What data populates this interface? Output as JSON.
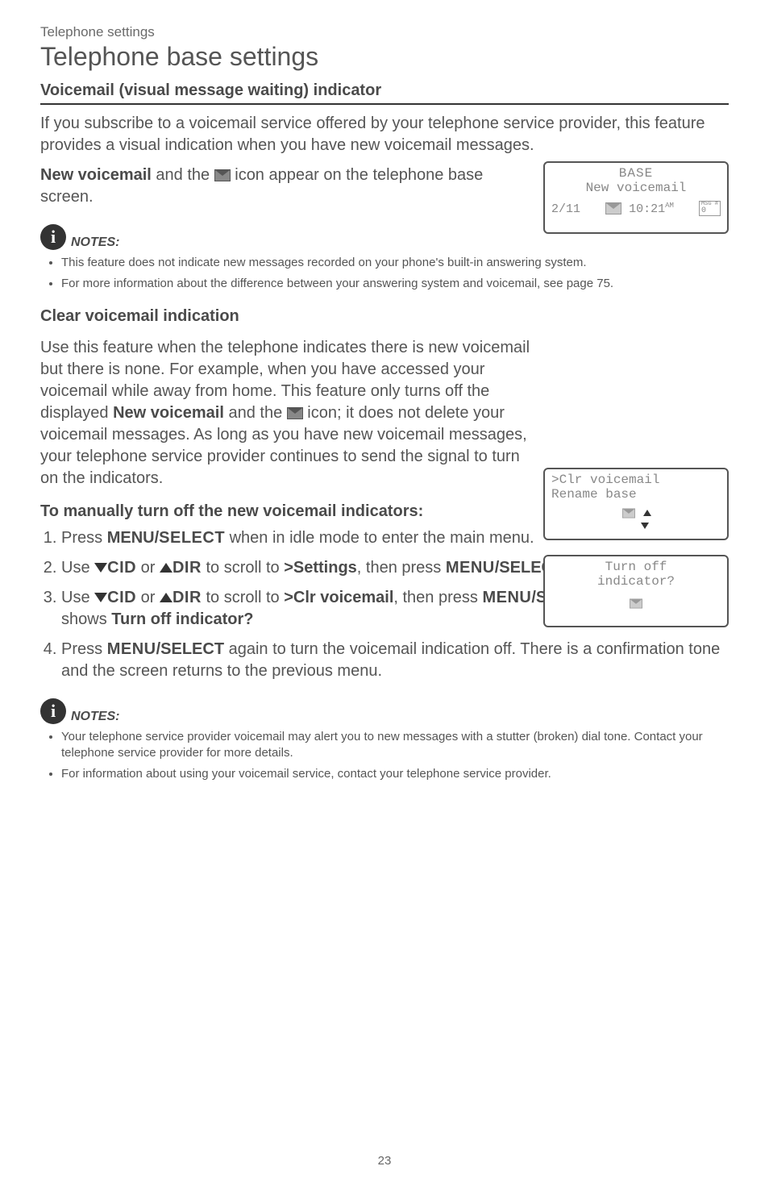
{
  "kicker": "Telephone settings",
  "title": "Telephone base settings",
  "section1": {
    "heading": "Voicemail (visual message waiting) indicator",
    "para1": "If you subscribe to a voicemail service offered by your telephone service provider, this feature provides a visual indication when you have new voicemail messages.",
    "para2_lead": "New voicemail",
    "para2_mid": " and the ",
    "para2_tail": " icon appear on the telephone base screen."
  },
  "lcd_top": {
    "row1": "BASE",
    "row2": "New voicemail",
    "date": "2/11",
    "time": "10:21",
    "ampm": "AM",
    "msg_label": "MSG #",
    "msg_count": "0"
  },
  "notes_label": "NOTES:",
  "notes1": [
    "This feature does not indicate new messages recorded on your phone's built-in answering system.",
    "For more information about the difference between your answering system and voicemail, see page 75."
  ],
  "section2": {
    "heading": "Clear voicemail indication",
    "para_a": "Use this feature when the telephone indicates there is new voicemail but there is none. For example, when you have accessed your voicemail while away from home. This feature only turns off the displayed ",
    "para_a_bold": "New voicemail",
    "para_a_mid": " and the ",
    "para_a_tail": " icon; it does not delete your voicemail messages. As long as you have new voicemail messages, your telephone service provider continues to send the signal to turn on the indicators."
  },
  "lcd_mid1": {
    "line1": ">Clr voicemail",
    "line2": " Rename base"
  },
  "lcd_mid2": {
    "line1": "Turn off",
    "line2": "indicator?"
  },
  "howto_heading": "To manually turn off the new voicemail indicators:",
  "steps": {
    "s1_a": "Press ",
    "s1_b": "MENU/",
    "s1_c": "SELECT",
    "s1_d": " when in idle mode to enter the main menu.",
    "s2_a": "Use ",
    "s2_cid": "CID",
    "s2_or": " or ",
    "s2_dir": "DIR",
    "s2_to": " to scroll to ",
    "s2_target": ">Settings",
    "s2_then": ", then press ",
    "s2_menu": "MENU",
    "s2_select": "/SELECT",
    "s2_end": ".",
    "s3_a": "Use ",
    "s3_target": ">Clr voicemail",
    "s3_then": ", then press ",
    "s3_menu": "MENU",
    "s3_select": "/SELECT",
    "s3_end1": ". The screen shows ",
    "s3_end_bold": "Turn off indicator?",
    "s4_a": "Press ",
    "s4_menu": "MENU",
    "s4_select": "/SELECT",
    "s4_b": " again to turn the voicemail indication off. There is a confirmation tone and the screen returns to the previous menu."
  },
  "notes2": [
    "Your telephone service provider voicemail may alert you to new messages with a stutter (broken) dial tone. Contact your telephone service provider for more details.",
    "For information about using your voicemail service, contact your telephone service provider."
  ],
  "page_number": "23"
}
